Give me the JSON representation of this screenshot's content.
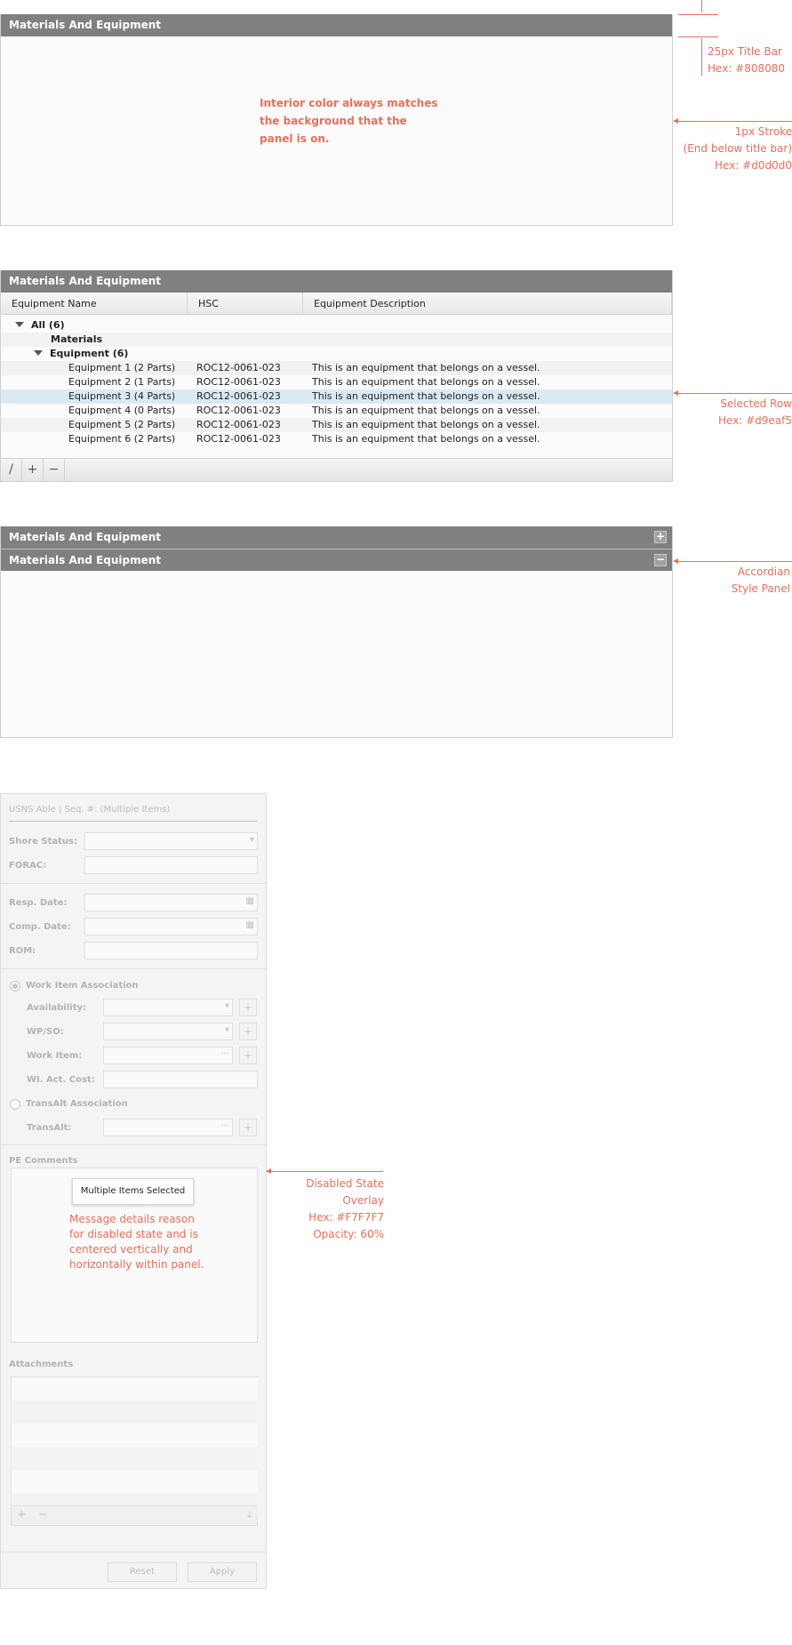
{
  "panel1": {
    "title": "Materials And Equipment",
    "interior_note": "Interior color always matches\nthe background that the\npanel is on.",
    "titlebar_note": "25px Title Bar\nHex: #808080",
    "stroke_note": "1px Stroke\n(End below title bar)\nHex: #d0d0d0"
  },
  "panel2": {
    "title": "Materials And Equipment",
    "columns": [
      "Equipment Name",
      "HSC",
      "Equipment Description"
    ],
    "groups": {
      "all": "All  (6)",
      "materials": "Materials",
      "equipment": "Equipment  (6)"
    },
    "rows": [
      {
        "name": "Equipment 1 (2 Parts)",
        "hsc": "ROC12-0061-023",
        "desc": "This is an equipment that belongs on a vessel."
      },
      {
        "name": "Equipment 2 (1 Parts)",
        "hsc": "ROC12-0061-023",
        "desc": "This is an equipment that belongs on a vessel."
      },
      {
        "name": "Equipment 3 (4 Parts)",
        "hsc": "ROC12-0061-023",
        "desc": "This is an equipment that belongs on a vessel."
      },
      {
        "name": "Equipment 4 (0 Parts)",
        "hsc": "ROC12-0061-023",
        "desc": "This is an equipment that belongs on a vessel."
      },
      {
        "name": "Equipment 5 (2 Parts)",
        "hsc": "ROC12-0061-023",
        "desc": "This is an equipment that belongs on a vessel."
      },
      {
        "name": "Equipment 6 (2 Parts)",
        "hsc": "ROC12-0061-023",
        "desc": "This is an equipment that belongs on a vessel."
      }
    ],
    "selected_row": 2,
    "toolbar_icons": [
      "edit-icon",
      "add-icon",
      "remove-icon"
    ],
    "selected_note": "Selected Row\nHex: #d9eaf5",
    "selected_color": "#d9eaf5"
  },
  "panel3": {
    "title_collapsed": "Materials And Equipment",
    "title_expanded": "Materials And Equipment",
    "expand_icon": "+",
    "collapse_icon": "−",
    "note": "Accordian\nStyle Panel"
  },
  "form": {
    "header": "USNS Able | Seq. #: (Multiple Items)",
    "shore_status_label": "Shore Status:",
    "forac_label": "FORAC:",
    "resp_date_label": "Resp. Date:",
    "comp_date_label": "Comp. Date:",
    "rom_label": "ROM:",
    "work_item_association": "Work Item Association",
    "availability_label": "Availability:",
    "wpso_label": "WP/SO:",
    "work_item_label": "Work Item:",
    "wi_act_cost_label": "WI. Act. Cost:",
    "transalt_association": "TransAlt Association",
    "transalt_label": "TransAlt:",
    "pe_comments_label": "PE Comments",
    "attachments_label": "Attachments",
    "reset_label": "Reset",
    "apply_label": "Apply",
    "overlay_message": "Multiple Items Selected",
    "reason_note": "Message details reason\nfor disabled state and is\ncentered vertically and\nhorizontally within panel.",
    "overlay_note": "Disabled State Overlay\nHex: #F7F7F7\nOpacity: 60%"
  },
  "colors": {
    "titlebar": "#808080",
    "stroke": "#d0d0d0",
    "selected": "#d9eaf5",
    "overlay": "#F7F7F7",
    "annotation": "#e8705a"
  }
}
